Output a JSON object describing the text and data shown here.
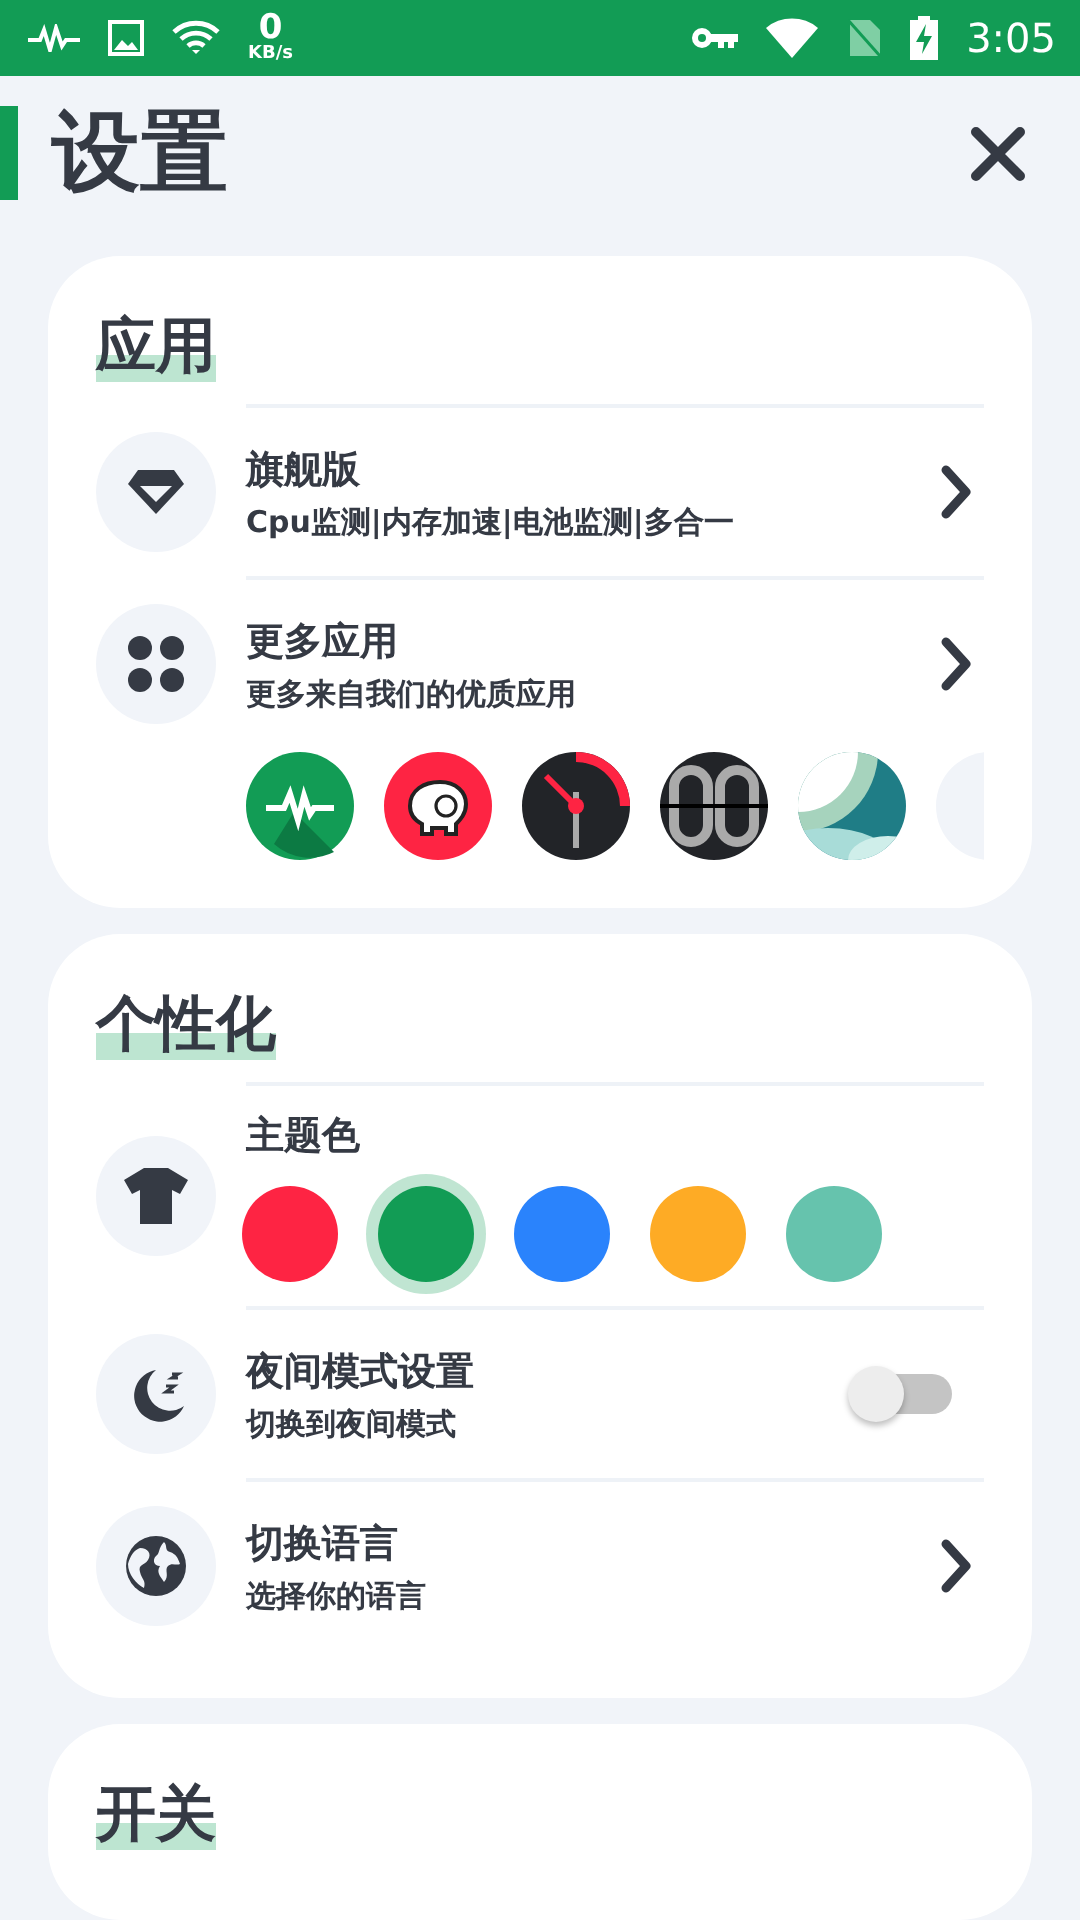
{
  "status_bar": {
    "net_speed": "0",
    "net_unit": "KB/s",
    "time": "3:05"
  },
  "header": {
    "title": "设置"
  },
  "sections": [
    {
      "title": "应用",
      "rows": [
        {
          "kind": "link",
          "title": "旗舰版",
          "subtitle": "Cpu监测|内存加速|电池监测|多合一"
        },
        {
          "kind": "apps",
          "title": "更多应用",
          "subtitle": "更多来自我们的优质应用"
        }
      ]
    },
    {
      "title": "个性化",
      "rows": [
        {
          "kind": "colors",
          "title": "主题色",
          "colors": [
            {
              "color": "#fe2443",
              "selected": false
            },
            {
              "color": "#129c55",
              "selected": true
            },
            {
              "color": "#2a83fc",
              "selected": false
            },
            {
              "color": "#feab25",
              "selected": false
            },
            {
              "color": "#66c3ad",
              "selected": false
            }
          ]
        },
        {
          "kind": "toggle",
          "title": "夜间模式设置",
          "subtitle": "切换到夜间模式",
          "on": false
        },
        {
          "kind": "link",
          "title": "切换语言",
          "subtitle": "选择你的语言"
        }
      ]
    },
    {
      "title": "开关"
    }
  ]
}
